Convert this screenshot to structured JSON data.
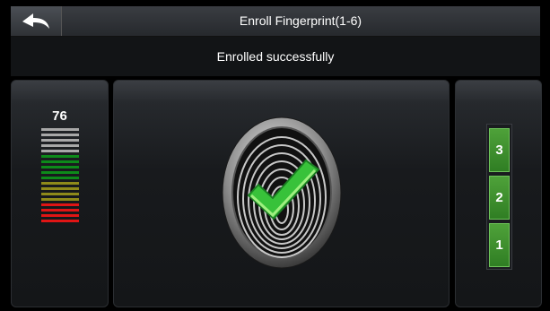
{
  "header": {
    "title": "Enroll Fingerprint(1-6)",
    "back_icon": "back-arrow-icon"
  },
  "status": {
    "message": "Enrolled successfully"
  },
  "quality": {
    "value": "76",
    "bars": [
      "#a8a8a8",
      "#a8a8a8",
      "#a8a8a8",
      "#a8a8a8",
      "#a8a8a8",
      "#0d8a1a",
      "#0d8a1a",
      "#0d8a1a",
      "#0d8a1a",
      "#0d8a1a",
      "#8f8a1a",
      "#8f8a1a",
      "#8f8a1a",
      "#8f8a1a",
      "#e01515",
      "#e01515",
      "#e01515",
      "#e01515"
    ]
  },
  "fingerprint": {
    "icon": "fingerprint-icon",
    "check_icon": "checkmark-icon",
    "accent": "#38c23a"
  },
  "steps": {
    "items": [
      "3",
      "2",
      "1"
    ],
    "color": "#3e9a2c"
  }
}
